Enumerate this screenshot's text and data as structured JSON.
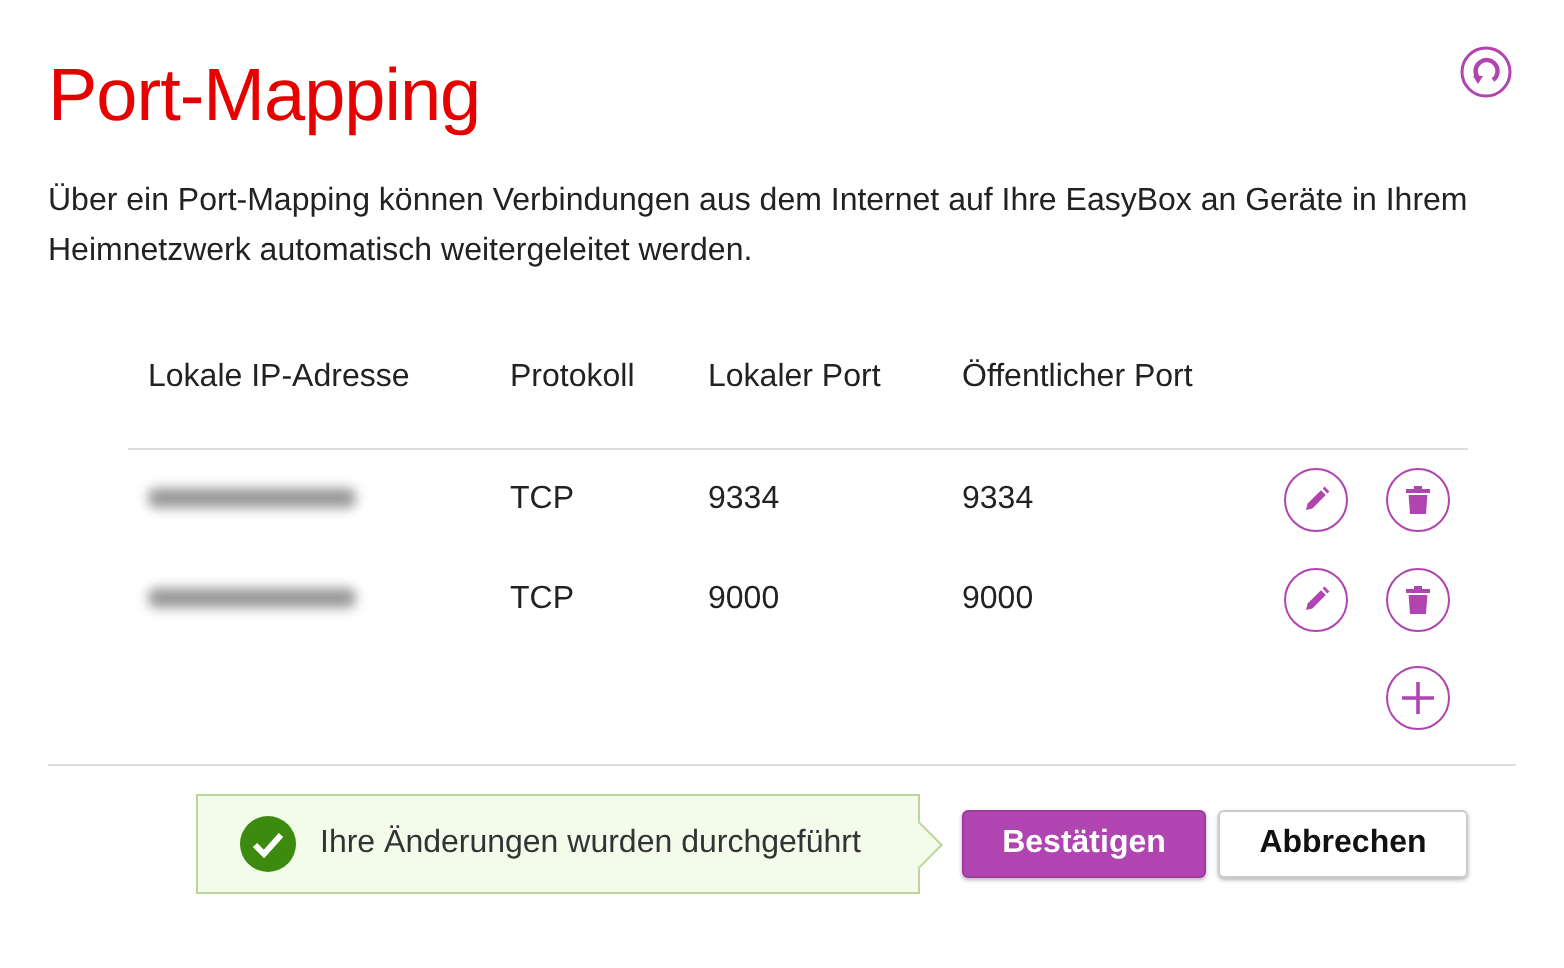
{
  "page": {
    "title": "Port-Mapping",
    "description": "Über ein Port-Mapping können Verbindungen aus dem Internet auf Ihre EasyBox an Geräte in Ihrem Heimnetzwerk automatisch weitergeleitet werden."
  },
  "table": {
    "columns": [
      "Lokale IP-Adresse",
      "Protokoll",
      "Lokaler Port",
      "Öffentlicher Port"
    ],
    "rows": [
      {
        "protocol": "TCP",
        "local_port": "9334",
        "public_port": "9334"
      },
      {
        "protocol": "TCP",
        "local_port": "9000",
        "public_port": "9000"
      }
    ]
  },
  "notification": {
    "kind": "success",
    "text": "Ihre Änderungen wurden durchgeführt"
  },
  "buttons": [
    {
      "label": "Bestätigen",
      "kind": "primary"
    },
    {
      "label": "Abbrechen",
      "kind": "secondary"
    }
  ]
}
